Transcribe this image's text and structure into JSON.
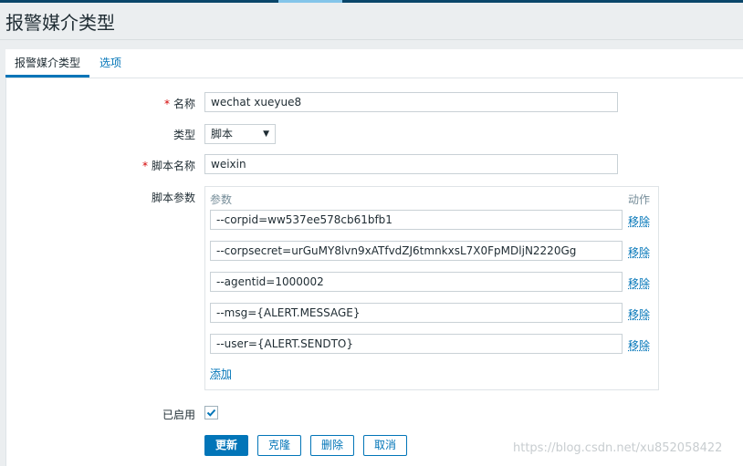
{
  "page": {
    "title": "报警媒介类型"
  },
  "tabs": [
    {
      "label": "报警媒介类型",
      "active": true
    },
    {
      "label": "选项",
      "active": false
    }
  ],
  "form": {
    "name_label": "名称",
    "name_required_mark": "*",
    "name_value": "wechat xueyue8",
    "type_label": "类型",
    "type_value": "脚本",
    "script_name_label": "脚本名称",
    "script_name_required_mark": "*",
    "script_name_value": "weixin",
    "script_params_label": "脚本参数",
    "params_header": {
      "param": "参数",
      "action": "动作"
    },
    "params": [
      {
        "value": "--corpid=ww537ee578cb61bfb1",
        "remove": "移除"
      },
      {
        "value": "--corpsecret=urGuMY8lvn9xATfvdZJ6tmnkxsL7X0FpMDljN2220Gg",
        "remove": "移除"
      },
      {
        "value": "--agentid=1000002",
        "remove": "移除"
      },
      {
        "value": "--msg={ALERT.MESSAGE}",
        "remove": "移除"
      },
      {
        "value": "--user={ALERT.SENDTO}",
        "remove": "移除"
      }
    ],
    "add_label": "添加",
    "enabled_label": "已启用",
    "enabled": true
  },
  "buttons": {
    "update": "更新",
    "clone": "克隆",
    "delete": "删除",
    "cancel": "取消"
  },
  "watermark": "https://blog.csdn.net/xu852058422",
  "colors": {
    "accent": "#0275b8",
    "required": "#d40000",
    "header_bar": "#0a466a"
  }
}
